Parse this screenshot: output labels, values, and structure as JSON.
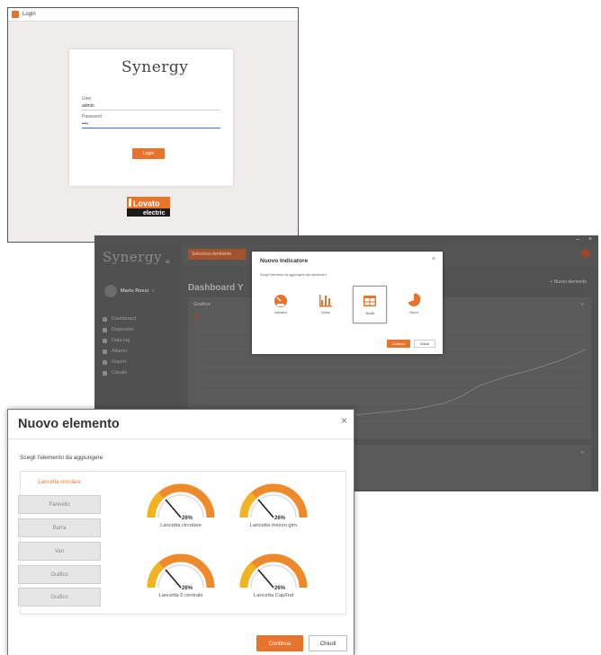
{
  "login_window": {
    "title": "Login",
    "logo_text": "Synergy",
    "user_label": "User",
    "user_value": "admin",
    "password_label": "Password",
    "password_value": "••••",
    "login_button": "Login",
    "brand_logo_top": "Lovato",
    "brand_logo_bottom": "electric"
  },
  "dashboard_window": {
    "window_controls": [
      "–",
      "×"
    ],
    "logo_text": "Synergy",
    "user_name": "Mario Rossi",
    "nav_items": [
      "Dashboard",
      "Dispositivi",
      "Data log",
      "Allarmi",
      "Report",
      "Canale"
    ],
    "ambiente_button": "Seleziona Ambiente",
    "page_title": "Dashboard Y",
    "new_element": "+ Nuovo elemento",
    "chart_panel_title": "Grafico",
    "modal": {
      "title": "Nuovo Indicatore",
      "subtitle": "Scegli l'elemento da aggiungere alla dashboard",
      "options": [
        "Indicatore",
        "Grafico",
        "Tabella",
        "Report"
      ],
      "selected_option": "Tabella",
      "continue_button": "Continua",
      "close_button": "Chiudi"
    }
  },
  "element_window": {
    "title": "Nuovo elemento",
    "close_icon": "×",
    "subtitle": "Scegli l'elemento da aggiungere",
    "tabs": [
      "Lancetta circolare",
      "Pannello",
      "Barra",
      "Vari",
      "Grafico",
      "Grafico"
    ],
    "active_tab": "Lancetta circolare",
    "gauges": [
      {
        "label": "Lancetta circolare",
        "value": "26%"
      },
      {
        "label": "Lancetta mezzo giro",
        "value": "26%"
      },
      {
        "label": "Lancetta 0 centrale",
        "value": "26%"
      },
      {
        "label": "Lancetta Cap/Ind",
        "value": "26%"
      }
    ],
    "continue_button": "Continua",
    "close_button": "Chiudi"
  },
  "colors": {
    "accent": "#e8732c",
    "gauge_yellow": "#f2b320",
    "gauge_orange": "#ef8a2a",
    "dashboard_bg": "#525252"
  }
}
